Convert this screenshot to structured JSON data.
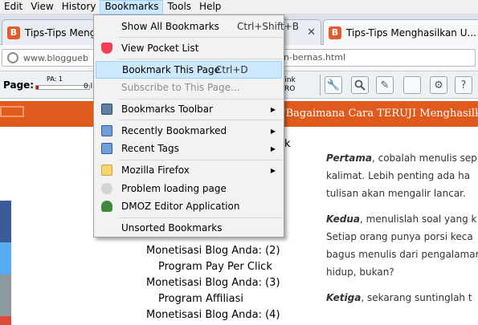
{
  "menubar": {
    "items": [
      "Edit",
      "View",
      "History",
      "Bookmarks",
      "Tools",
      "Help"
    ]
  },
  "tabs": [
    {
      "title": "Tips-Tips Menghasi"
    },
    {
      "title": "Tips-Tips Menghasilkan U..."
    }
  ],
  "navbar": {
    "url_start": "www.bloggueb",
    "url_end": "n-bernas.html"
  },
  "addonbar": {
    "page_label": "Page:",
    "pa_label": "PA: 1",
    "pa_zero": "0 li",
    "more_link_l1": "re link",
    "more_link_l2": "h PRO"
  },
  "bookmarks_menu": {
    "show_all": {
      "label": "Show All Bookmarks",
      "shortcut": "Ctrl+Shift+B"
    },
    "view_pocket": {
      "label": "View Pocket List"
    },
    "bookmark_page": {
      "label": "Bookmark This Page",
      "shortcut": "Ctrl+D"
    },
    "subscribe": {
      "label": "Subscribe to This Page..."
    },
    "bookmarks_toolbar": {
      "label": "Bookmarks Toolbar"
    },
    "recently_bookmarked": {
      "label": "Recently Bookmarked"
    },
    "recent_tags": {
      "label": "Recent Tags"
    },
    "mozilla_firefox": {
      "label": "Mozilla Firefox"
    },
    "problem_loading": {
      "label": "Problem loading page"
    },
    "dmoz": {
      "label": "DMOZ Editor Application"
    },
    "unsorted": {
      "label": "Unsorted Bookmarks"
    }
  },
  "page": {
    "banner_text": "'Bagaimana Cara TERUJI Menghasilka",
    "frag_k": "k",
    "related": [
      {
        "l1": "Monetisasi Blog Anda: (2)",
        "l2": "Program Pay Per Click"
      },
      {
        "l1": "Monetisasi Blog Anda: (3)",
        "l2": "Program Affiliasi"
      },
      {
        "l1": "Monetisasi Blog Anda: (4)",
        "l2": ""
      }
    ],
    "article": {
      "p1_bold": "Pertama",
      "p1_rest": ", cobalah menulis sep",
      "p1_line2": "kalimat. Lebih penting ada ha",
      "p1_line3": "tulisan akan mengalir lancar.",
      "p2_bold": "Kedua",
      "p2_rest": ", menulislah soal yang k",
      "p2_line2": "Setiap orang punya porsi keca",
      "p2_line3": "bagus menulis dari pengalamar",
      "p2_line4": "hidup, bukan?",
      "p3_bold": "Ketiga",
      "p3_rest": ", sekarang suntinglah t"
    }
  },
  "colors": {
    "banner": "#e05a1e",
    "menu_highlight": "#cce8ff",
    "pocket": "#ef4056"
  }
}
